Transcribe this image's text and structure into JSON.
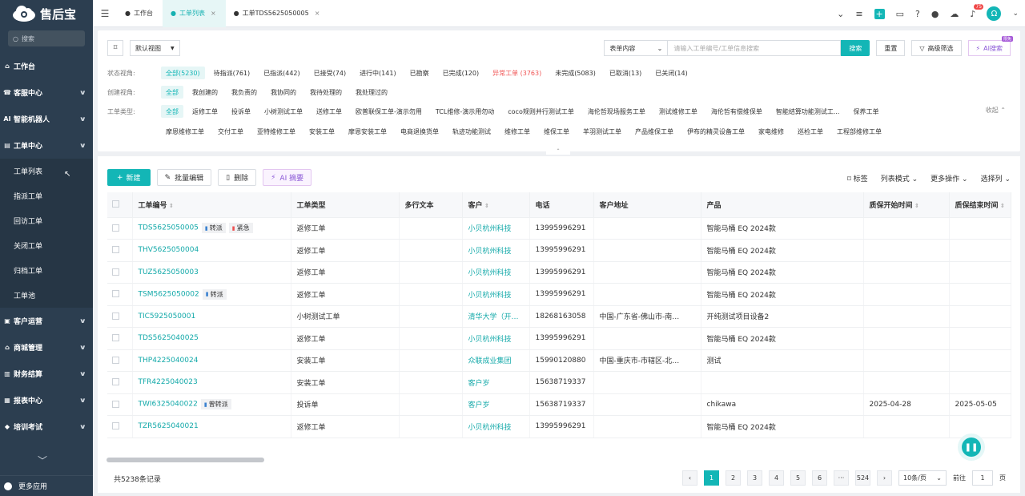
{
  "app": {
    "name": "售后宝"
  },
  "sidebar": {
    "search_placeholder": "搜索",
    "items": [
      {
        "label": "工作台",
        "icon": "home-icon",
        "glyph": "⌂"
      },
      {
        "label": "客服中心",
        "icon": "service-icon",
        "glyph": "☎"
      },
      {
        "label": "智能机器人",
        "icon": "ai-icon",
        "glyph": "AI"
      },
      {
        "label": "工单中心",
        "icon": "workorder-icon",
        "glyph": "▤"
      }
    ],
    "sub_items": [
      "工单列表",
      "指派工单",
      "回访工单",
      "关闭工单",
      "归档工单",
      "工单池"
    ],
    "items2": [
      {
        "label": "客户运营",
        "icon": "customer-icon",
        "glyph": "▣"
      },
      {
        "label": "商城管理",
        "icon": "mall-icon",
        "glyph": "⌂"
      },
      {
        "label": "财务结算",
        "icon": "finance-icon",
        "glyph": "▥"
      },
      {
        "label": "报表中心",
        "icon": "report-icon",
        "glyph": "▦"
      },
      {
        "label": "培训考试",
        "icon": "training-icon",
        "glyph": "◆"
      }
    ],
    "more_apps": "更多应用"
  },
  "tabs": [
    {
      "label": "工作台",
      "active": false,
      "closable": false
    },
    {
      "label": "工单列表",
      "active": true,
      "closable": true
    },
    {
      "label": "工单TDS5625050005",
      "active": false,
      "closable": true
    }
  ],
  "notifications": {
    "count": "75"
  },
  "avatar_letter": "Ω",
  "filters": {
    "view": "默认视图",
    "search_scope": "表单内容",
    "search_placeholder": "请输入工单编号/工单信息搜索",
    "search_btn": "搜索",
    "reset_btn": "重置",
    "advanced_btn": "高级筛选",
    "ai_search_btn": "AI搜索",
    "ai_corner": "限免",
    "status_label": "状态视角:",
    "status": [
      "全部(5230)",
      "待指派(761)",
      "已指派(442)",
      "已接受(74)",
      "进行中(141)",
      "已勘察",
      "已完成(120)",
      "异常工单 (3763)",
      "未完成(5083)",
      "已取消(13)",
      "已关闭(14)"
    ],
    "create_label": "创建视角:",
    "create": [
      "全部",
      "我创建的",
      "我负责的",
      "我协同的",
      "我待处理的",
      "我处理过的"
    ],
    "type_label": "工单类型:",
    "types_row1": [
      "全部",
      "返修工单",
      "投诉单",
      "小树测试工单",
      "送修工单",
      "欧普联保工单-演示勿用",
      "TCL维修-演示用勿动",
      "coco规则并行测试工单",
      "海伦哲现场服务工单",
      "测试维修工单",
      "海伦哲有偿维保单",
      "智能结算功能测试工...",
      "保养工单"
    ],
    "types_row2": [
      "摩恩维修工单",
      "交付工单",
      "亚特维修工单",
      "安装工单",
      "摩恩安装工单",
      "电商退换货单",
      "轨迹功能测试",
      "维修工单",
      "维保工单",
      "羊羽测试工单",
      "产品维保工单",
      "伊布的精灵设备工单",
      "家电维修",
      "巡检工单",
      "工程部维修工单"
    ],
    "collapse": "收起"
  },
  "actions": {
    "new": "新建",
    "batch_edit": "批量编辑",
    "delete": "删除",
    "ai_summary": "AI 摘要"
  },
  "tools": {
    "tag": "标签",
    "list_mode": "列表模式",
    "more_ops": "更多操作",
    "select_cols": "选择列"
  },
  "table": {
    "columns": [
      "工单编号",
      "工单类型",
      "多行文本",
      "客户",
      "电话",
      "客户地址",
      "产品",
      "质保开始时间",
      "质保结束时间"
    ],
    "sortable": [
      true,
      false,
      false,
      true,
      false,
      false,
      false,
      true,
      true
    ],
    "rows": [
      {
        "id": "TDS5625050005",
        "tags": [
          {
            "t": "转派",
            "c": "blue"
          },
          {
            "t": "紧急",
            "c": "red"
          }
        ],
        "type": "返修工单",
        "text": "",
        "customer": "小贝杭州科技",
        "phone": "13995996291",
        "address": "",
        "product": "智能马桶 EQ 2024款",
        "ws": "",
        "we": ""
      },
      {
        "id": "THV5625050004",
        "tags": [],
        "type": "返修工单",
        "text": "",
        "customer": "小贝杭州科技",
        "phone": "13995996291",
        "address": "",
        "product": "智能马桶 EQ 2024款",
        "ws": "",
        "we": ""
      },
      {
        "id": "TUZ5625050003",
        "tags": [],
        "type": "返修工单",
        "text": "",
        "customer": "小贝杭州科技",
        "phone": "13995996291",
        "address": "",
        "product": "智能马桶 EQ 2024款",
        "ws": "",
        "we": ""
      },
      {
        "id": "TSM5625050002",
        "tags": [
          {
            "t": "转派",
            "c": "blue"
          }
        ],
        "type": "返修工单",
        "text": "",
        "customer": "小贝杭州科技",
        "phone": "13995996291",
        "address": "",
        "product": "智能马桶 EQ 2024款",
        "ws": "",
        "we": ""
      },
      {
        "id": "TIC5925050001",
        "tags": [],
        "type": "小树测试工单",
        "text": "",
        "customer": "清华大学（开…",
        "phone": "18268163058",
        "address": "中国-广东省-佛山市-南…",
        "product": "开纯测试项目设备2",
        "ws": "",
        "we": ""
      },
      {
        "id": "TDS5625040025",
        "tags": [],
        "type": "返修工单",
        "text": "",
        "customer": "小贝杭州科技",
        "phone": "13995996291",
        "address": "",
        "product": "智能马桶 EQ 2024款",
        "ws": "",
        "we": ""
      },
      {
        "id": "THP4225040024",
        "tags": [],
        "type": "安装工单",
        "text": "",
        "customer": "众联成业集团",
        "phone": "15990120880",
        "address": "中国-重庆市-市辖区-北…",
        "product": "测试",
        "ws": "",
        "we": ""
      },
      {
        "id": "TFR4225040023",
        "tags": [],
        "type": "安装工单",
        "text": "",
        "customer": "客户岁",
        "phone": "15638719337",
        "address": "",
        "product": "",
        "ws": "",
        "we": ""
      },
      {
        "id": "TWI6325040022",
        "tags": [
          {
            "t": "曾转派",
            "c": "blue"
          }
        ],
        "type": "投诉单",
        "text": "",
        "customer": "客户岁",
        "phone": "15638719337",
        "address": "",
        "product": "chikawa",
        "ws": "2025-04-28",
        "we": "2025-05-05"
      },
      {
        "id": "TZR5625040021",
        "tags": [],
        "type": "返修工单",
        "text": "",
        "customer": "小贝杭州科技",
        "phone": "13995996291",
        "address": "",
        "product": "智能马桶 EQ 2024款",
        "ws": "",
        "we": ""
      }
    ]
  },
  "footer": {
    "total": "共5238条记录",
    "pages": [
      "1",
      "2",
      "3",
      "4",
      "5",
      "6",
      "···",
      "524"
    ],
    "page_size": "10条/页",
    "goto_label": "前往",
    "goto_value": "1",
    "page_unit": "页"
  },
  "colors": {
    "accent": "#13b6b6",
    "sidebar": "#2c3e50",
    "danger": "#f05454",
    "ai": "#8b58d7"
  }
}
